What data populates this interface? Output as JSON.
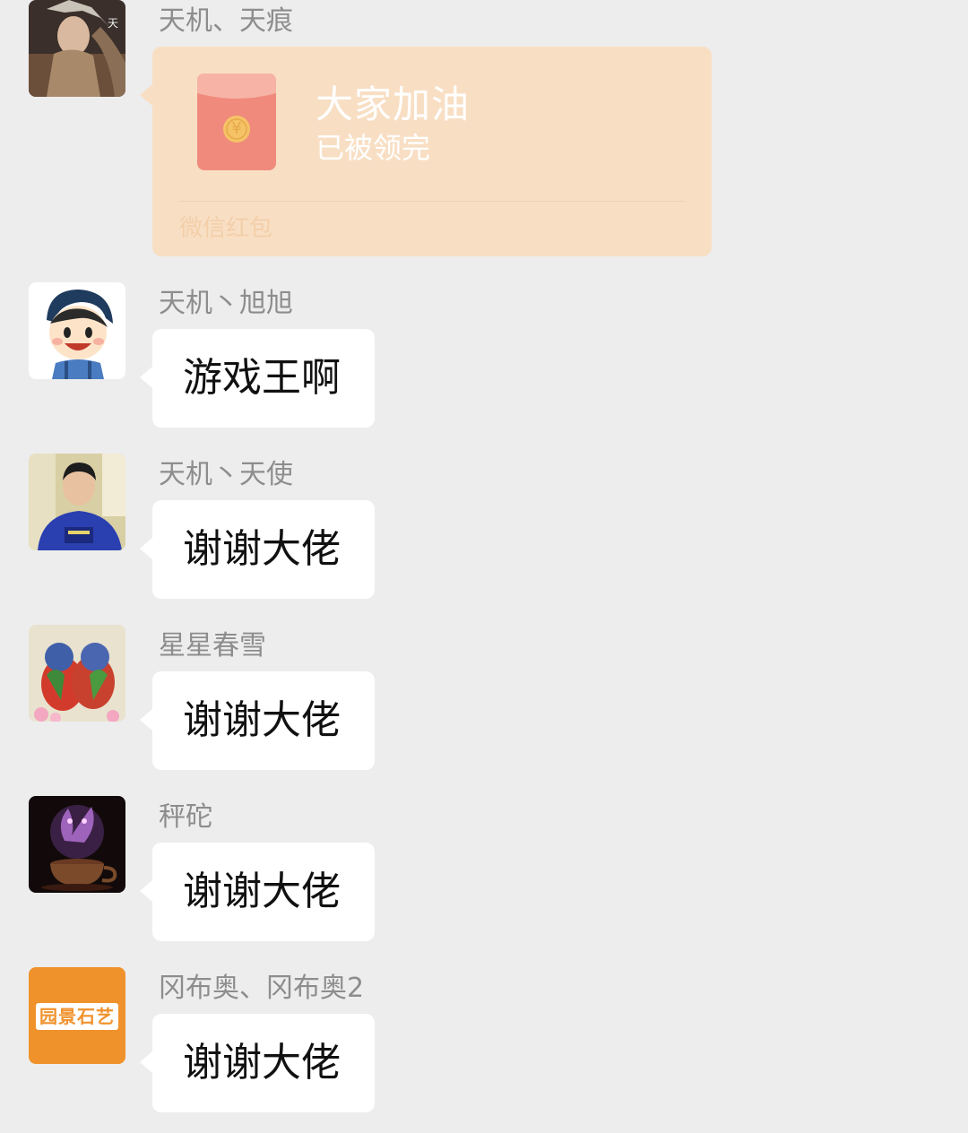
{
  "messages": [
    {
      "sender": "天机、天痕",
      "avatar": "costume-portrait-avatar",
      "red_packet": {
        "title": "大家加油",
        "status": "已被领完",
        "footer": "微信红包",
        "coin_symbol": "¥"
      }
    },
    {
      "sender": "天机丶旭旭",
      "avatar": "cartoon-boy-avatar",
      "text": "游戏王啊"
    },
    {
      "sender": "天机丶天使",
      "avatar": "man-in-blue-shirt-avatar",
      "text": "谢谢大佬"
    },
    {
      "sender": "星星春雪",
      "avatar": "parrots-avatar",
      "text": "谢谢大佬"
    },
    {
      "sender": "秤砣",
      "avatar": "tea-cup-avatar",
      "text": "谢谢大佬"
    },
    {
      "sender": "冈布奥、冈布奥2",
      "avatar": "garden-logo-avatar",
      "avatar_text": "园景石艺",
      "text": "谢谢大佬"
    }
  ],
  "colors": {
    "background": "#ededed",
    "bubble": "#ffffff",
    "red_packet": "#f8dfc4",
    "envelope": "#f08a7c",
    "coin": "#f5c266",
    "sender_text": "#8d8d8d"
  }
}
